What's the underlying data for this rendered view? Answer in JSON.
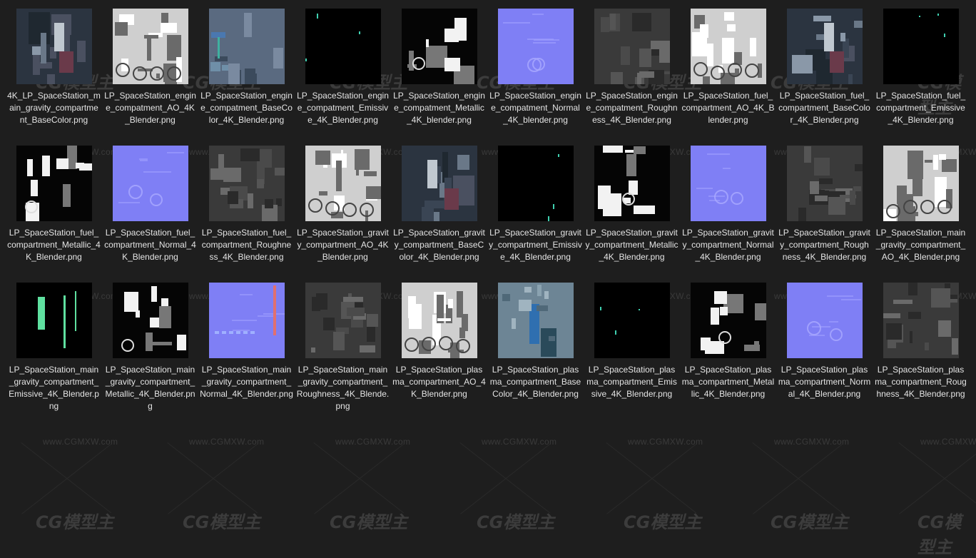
{
  "colors": {
    "background": "#1e1e1e",
    "caption": "#e4e4e4",
    "watermark": "#3a3a3a"
  },
  "watermark": {
    "url": "www.CGMXW.com",
    "logo": "CG模型主"
  },
  "files": [
    {
      "name": "4K_LP_SpaceStation_main_gravity_compartment_BaseColor.png",
      "kind": "basecolor"
    },
    {
      "name": "LP_SpaceStation_engine_compatment_AO_4K_Blender.png",
      "kind": "ao"
    },
    {
      "name": "LP_SpaceStation_engine_compatment_BaseColor_4K_Blender.png",
      "kind": "basecolor2"
    },
    {
      "name": "LP_SpaceStation_engine_compatment_Emissive_4K_Blender.png",
      "kind": "emissive"
    },
    {
      "name": "LP_SpaceStation_engine_compatment_Metallic_4K_blender.png",
      "kind": "metallic"
    },
    {
      "name": "LP_SpaceStation_engine_compatment_Normal_4K_blender.png",
      "kind": "normal"
    },
    {
      "name": "LP_SpaceStation_engine_compatment_Roughness_4K_Blender.png",
      "kind": "roughness"
    },
    {
      "name": "LP_SpaceStation_fuel_compartment_AO_4K_Blender.png",
      "kind": "ao"
    },
    {
      "name": "LP_SpaceStation_fuel_compartment_BaseColor_4K_Blender.png",
      "kind": "basecolor"
    },
    {
      "name": "LP_SpaceStation_fuel_compartment_Emissive_4K_Blender.png",
      "kind": "emissive"
    },
    {
      "name": "LP_SpaceStation_fuel_compartment_Metallic_4K_Blender.png",
      "kind": "metallic"
    },
    {
      "name": "LP_SpaceStation_fuel_compartment_Normal_4K_Blender.png",
      "kind": "normal"
    },
    {
      "name": "LP_SpaceStation_fuel_compartment_Roughness_4K_Blender.png",
      "kind": "roughness"
    },
    {
      "name": "LP_SpaceStation_gravity_compartment_AO_4K_Blender.png",
      "kind": "ao"
    },
    {
      "name": "LP_SpaceStation_gravity_compartment_BaseColor_4K_Blender.png",
      "kind": "basecolor"
    },
    {
      "name": "LP_SpaceStation_gravity_compartment_Emissive_4K_Blender.png",
      "kind": "emissive"
    },
    {
      "name": "LP_SpaceStation_gravity_compartment_Metallic_4K_Blender.png",
      "kind": "metallic"
    },
    {
      "name": "LP_SpaceStation_gravity_compartment_Normal_4K_Blender.png",
      "kind": "normal"
    },
    {
      "name": "LP_SpaceStation_gravity_compartment_Roughness_4K_Blender.png",
      "kind": "roughness"
    },
    {
      "name": "LP_SpaceStation_main_gravity_compartment_AO_4K_Blender.png",
      "kind": "ao"
    },
    {
      "name": "LP_SpaceStation_main_gravity_compartment_Emissive_4K_Blender.png",
      "kind": "emissive2"
    },
    {
      "name": "LP_SpaceStation_main_gravity_compartment_Metallic_4K_Blender.png",
      "kind": "metallic"
    },
    {
      "name": "LP_SpaceStation_main_gravity_compartment_Normal_4K_Blender.png",
      "kind": "normal2"
    },
    {
      "name": "LP_SpaceStation_main_gravity_compartment_Roughness_4K_Blende.png",
      "kind": "roughness"
    },
    {
      "name": "LP_SpaceStation_plasma_compartment_AO_4K_Blender.png",
      "kind": "ao"
    },
    {
      "name": "LP_SpaceStation_plasma_compartment_BaseColor_4K_Blender.png",
      "kind": "basecolor3"
    },
    {
      "name": "LP_SpaceStation_plasma_compartment_Emissive_4K_Blender.png",
      "kind": "emissive"
    },
    {
      "name": "LP_SpaceStation_plasma_compartment_Metallic_4K_Blender.png",
      "kind": "metallic"
    },
    {
      "name": "LP_SpaceStation_plasma_compartment_Normal_4K_Blender.png",
      "kind": "normal"
    },
    {
      "name": "LP_SpaceStation_plasma_compartment_Roughness_4K_Blender.png",
      "kind": "roughness"
    }
  ]
}
